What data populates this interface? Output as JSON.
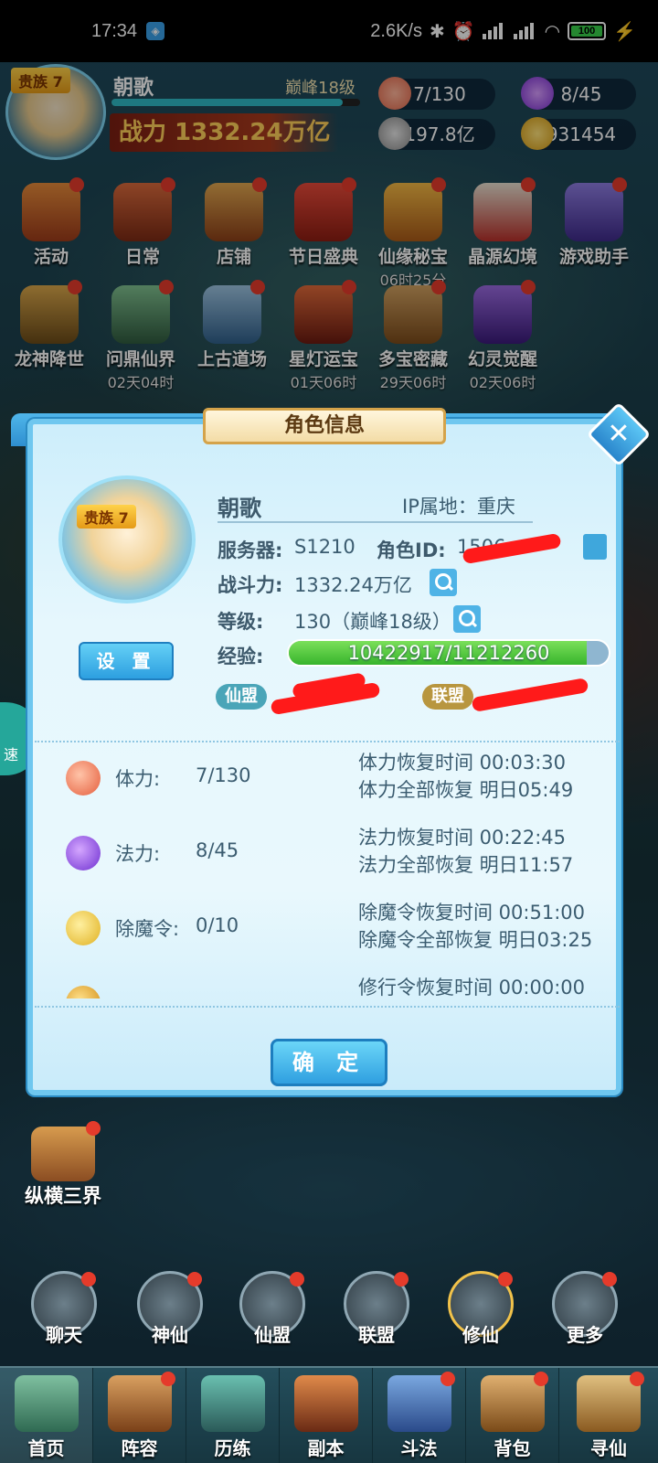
{
  "status_bar": {
    "time": "17:34",
    "net_speed": "2.6K/s",
    "network1": "HD",
    "network2": "HD",
    "battery": "100"
  },
  "hud": {
    "rank_badge": "贵族 7",
    "player_name": "朝歌",
    "peak_level": "巅峰18级",
    "power": "战力 1332.24万亿",
    "stamina": "7/130",
    "mana": "8/45",
    "silver": "197.8亿",
    "gold": "931454"
  },
  "activities": [
    {
      "label": "活动",
      "timer": ""
    },
    {
      "label": "日常",
      "timer": ""
    },
    {
      "label": "店铺",
      "timer": ""
    },
    {
      "label": "节日盛典",
      "timer": ""
    },
    {
      "label": "仙缘秘宝",
      "timer": "06时25分"
    },
    {
      "label": "晶源幻境",
      "timer": ""
    },
    {
      "label": "游戏助手",
      "timer": ""
    },
    {
      "label": "龙神降世",
      "timer": ""
    },
    {
      "label": "问鼎仙界",
      "timer": "02天04时"
    },
    {
      "label": "上古道场",
      "timer": ""
    },
    {
      "label": "星灯运宝",
      "timer": "01天06时"
    },
    {
      "label": "多宝密藏",
      "timer": "29天06时"
    },
    {
      "label": "幻灵觉醒",
      "timer": "02天06时"
    }
  ],
  "dialog": {
    "title": "角色信息",
    "close": "✕",
    "badge": "贵族 7",
    "settings_label": "设 置",
    "name": "朝歌",
    "ip_label": "IP属地：重庆",
    "server_label": "服务器:",
    "server_value": "S1210",
    "role_id_label": "角色ID:",
    "role_id_value": "1506",
    "power_label": "战斗力:",
    "power_value": "1332.24万亿",
    "level_label": "等级:",
    "level_value": "130（巅峰18级）",
    "exp_label": "经验:",
    "exp_value": "10422917/11212260",
    "exp_fraction": 0.93,
    "guild_tag": "仙盟",
    "alliance_tag": "联盟",
    "resources": [
      {
        "name": "体力:",
        "value": "7/130",
        "line1": "体力恢复时间 00:03:30",
        "line2": "体力全部恢复 明日05:49",
        "icon": "peach-icon"
      },
      {
        "name": "法力:",
        "value": "8/45",
        "line1": "法力恢复时间 00:22:45",
        "line2": "法力全部恢复 明日11:57",
        "icon": "flame-icon"
      },
      {
        "name": "除魔令:",
        "value": "0/10",
        "line1": "除魔令恢复时间 00:51:00",
        "line2": "除魔令全部恢复 明日03:25",
        "icon": "token-icon"
      },
      {
        "name": "",
        "value": "",
        "line1": "修行令恢复时间 00:00:00",
        "line2": "",
        "icon": "scroll-icon"
      }
    ],
    "confirm_label": "确 定"
  },
  "side": {
    "speed_label": "速",
    "zongheng_label": "纵横三界"
  },
  "quick_buttons": [
    "聊天",
    "神仙",
    "仙盟",
    "联盟",
    "修仙",
    "更多"
  ],
  "nav": [
    "首页",
    "阵容",
    "历练",
    "副本",
    "斗法",
    "背包",
    "寻仙"
  ]
}
